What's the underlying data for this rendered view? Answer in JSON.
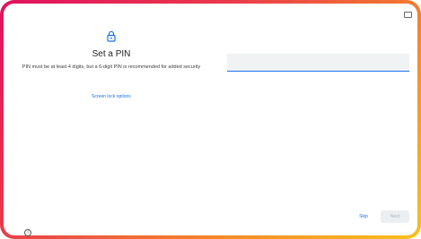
{
  "header": {
    "title": "Set a PIN",
    "subtitle": "PIN must be at least 4 digits, but a 6-digit PIN is recommended for added security",
    "icon": "lock-icon"
  },
  "options_link": "Screen lock options",
  "pin_field": {
    "value": "",
    "placeholder": ""
  },
  "footer": {
    "skip_label": "Skip",
    "next_label": "Next",
    "info_icon": "info-icon"
  },
  "status_bar": {
    "icon": "screen-cast-icon"
  },
  "colors": {
    "accent": "#1a73e8",
    "frame_start": "#e0115f",
    "frame_end": "#f7c21c",
    "disabled_text": "#b0b4b8"
  }
}
